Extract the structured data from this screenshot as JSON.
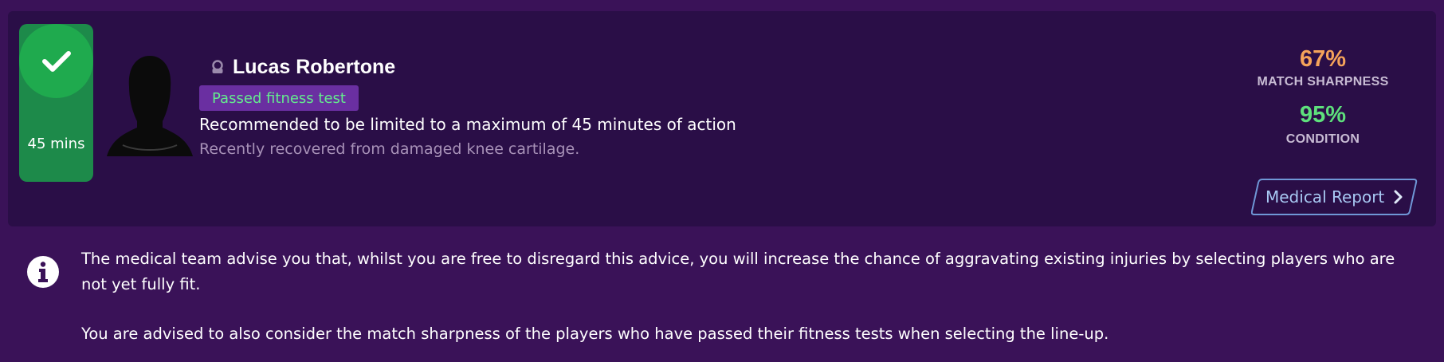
{
  "player_card": {
    "fitness_limit": "45 mins",
    "player_name": "Lucas Robertone",
    "status_badge": "Passed fitness test",
    "recommendation": "Recommended to be limited to a maximum of 45 minutes of action",
    "injury_note": "Recently recovered from damaged knee cartilage.",
    "match_sharpness": {
      "value": "67%",
      "label": "MATCH SHARPNESS"
    },
    "condition": {
      "value": "95%",
      "label": "CONDITION"
    },
    "medical_report_label": "Medical Report"
  },
  "advice": {
    "paragraph_1": "The medical team advise you that, whilst you are free to disregard this advice, you will increase the chance of aggravating existing injuries by selecting players who are not yet fully fit.",
    "paragraph_2": "You are advised to also consider the match sharpness of the players who have passed their fitness tests when selecting the line-up."
  },
  "colors": {
    "background": "#3a1258",
    "card": "#2a0e47",
    "fitness_green": "#1faa4e",
    "badge_bg": "#6a2fa1",
    "badge_text": "#64ec8e",
    "sharpness": "#f5a35a",
    "condition": "#5ee07c",
    "link": "#a8c9f3"
  },
  "icons": {
    "fitness_status": "checkmark-icon",
    "player_status": "person-icon",
    "info": "info-icon",
    "button_chevron": "chevron-right-icon"
  }
}
